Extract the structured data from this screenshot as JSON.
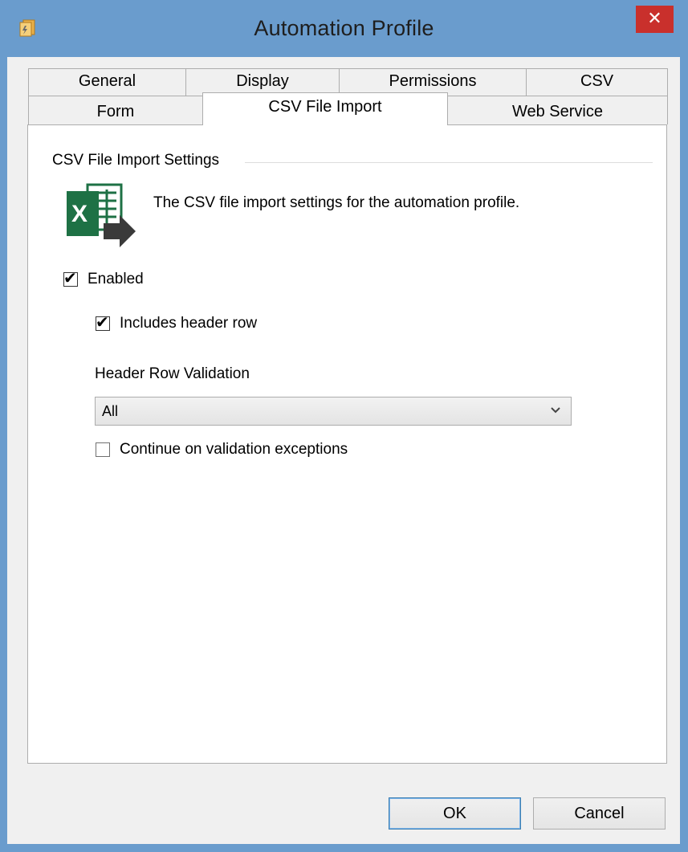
{
  "window": {
    "title": "Automation Profile",
    "close_label": "✕",
    "app_icon": "automation-profile-icon"
  },
  "tabs": {
    "row1": [
      {
        "label": "General"
      },
      {
        "label": "Display"
      },
      {
        "label": "Permissions"
      },
      {
        "label": "CSV"
      }
    ],
    "row2": [
      {
        "label": "Form"
      },
      {
        "label": "CSV File Import",
        "active": true
      },
      {
        "label": "Web Service"
      }
    ]
  },
  "panel": {
    "group_title": "CSV File Import Settings",
    "icon": "excel-import-icon",
    "description": "The CSV file import settings for the automation profile.",
    "enabled": {
      "label": "Enabled",
      "checked": true
    },
    "includes_header": {
      "label": "Includes header row",
      "checked": true
    },
    "header_validation": {
      "label": "Header Row Validation",
      "value": "All"
    },
    "continue_on_exceptions": {
      "label": "Continue on validation exceptions",
      "checked": false
    }
  },
  "buttons": {
    "ok": "OK",
    "cancel": "Cancel"
  },
  "colors": {
    "frame": "#6a9ccd",
    "close": "#c9302c",
    "excel_green": "#1e7145",
    "arrow": "#3a3a3a"
  }
}
